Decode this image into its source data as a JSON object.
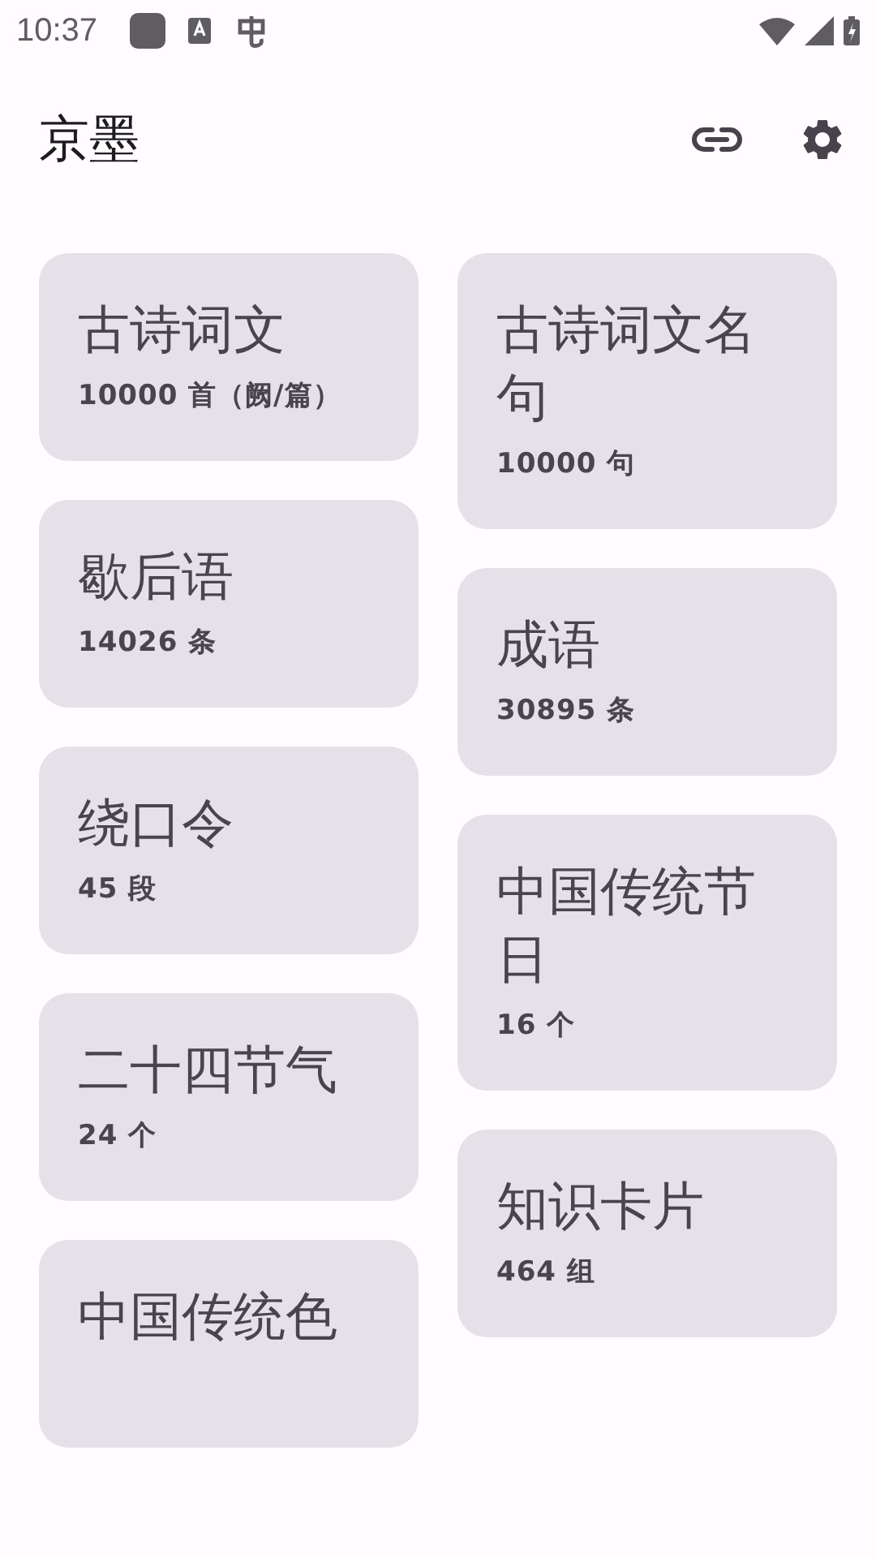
{
  "status_bar": {
    "time": "10:37"
  },
  "app_bar": {
    "title": "京墨"
  },
  "cards": [
    {
      "title": "古诗词文",
      "count": "10000 首（阙/篇）"
    },
    {
      "title": "古诗词文名句",
      "count": "10000 句"
    },
    {
      "title": "歇后语",
      "count": "14026 条"
    },
    {
      "title": "成语",
      "count": "30895 条"
    },
    {
      "title": "绕口令",
      "count": "45 段"
    },
    {
      "title": "中国传统节日",
      "count": "16 个"
    },
    {
      "title": "二十四节气",
      "count": "24 个"
    },
    {
      "title": "知识卡片",
      "count": "464 组"
    },
    {
      "title": "中国传统色"
    }
  ]
}
